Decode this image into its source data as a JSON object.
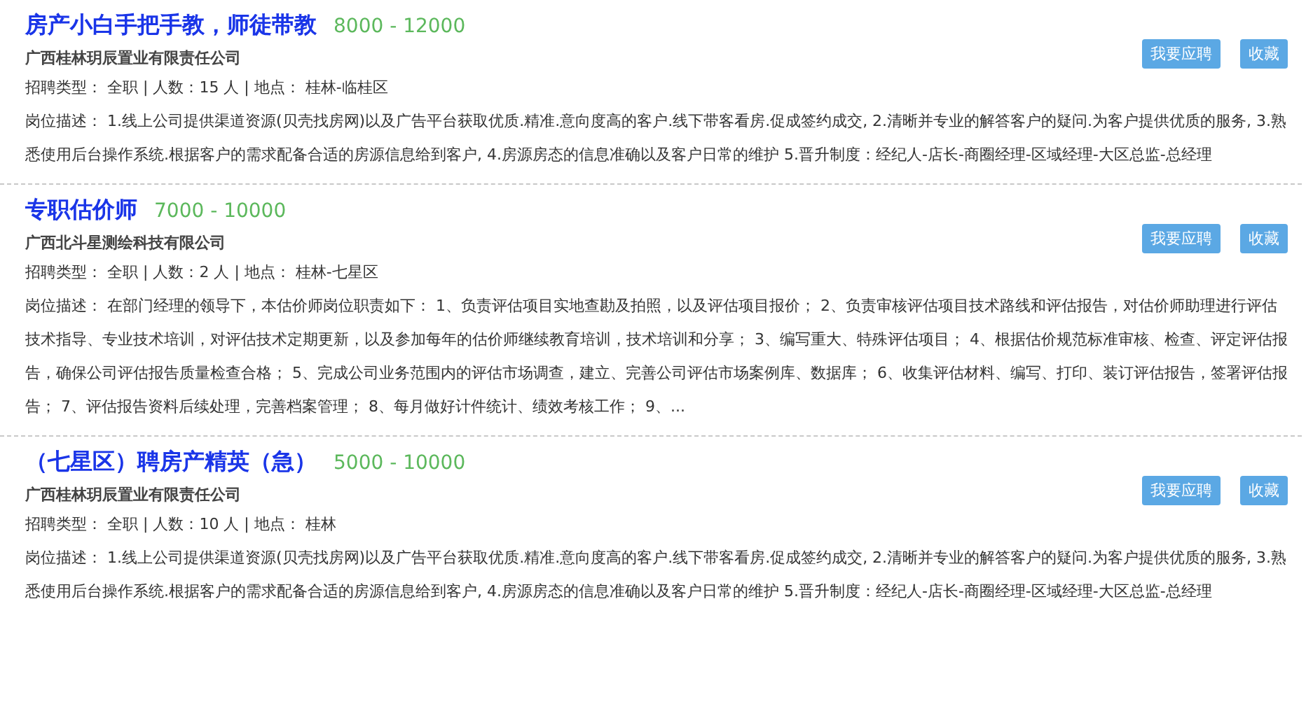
{
  "jobs": [
    {
      "title": "房产小白手把手教，师徒带教",
      "salary": "8000 - 12000",
      "company": "广西桂林玥辰置业有限责任公司",
      "meta": "招聘类型： 全职 | 人数：15 人 | 地点： 桂林-临桂区",
      "desc_label": "岗位描述：",
      "desc": "1.线上公司提供渠道资源(贝壳找房网)以及广告平台获取优质.精准.意向度高的客户.线下带客看房.促成签约成交, 2.清晰并专业的解答客户的疑问.为客户提供优质的服务, 3.熟悉使用后台操作系统.根据客户的需求配备合适的房源信息给到客户, 4.房源房态的信息准确以及客户日常的维护 5.晋升制度：经纪人-店长-商圈经理-区域经理-大区总监-总经理",
      "apply": "我要应聘",
      "save": "收藏"
    },
    {
      "title": "专职估价师",
      "salary": "7000 - 10000",
      "company": "广西北斗星测绘科技有限公司",
      "meta": "招聘类型： 全职 | 人数：2 人 | 地点： 桂林-七星区",
      "desc_label": "岗位描述：",
      "desc": "在部门经理的领导下，本估价师岗位职责如下： 1、负责评估项目实地查勘及拍照，以及评估项目报价； 2、负责审核评估项目技术路线和评估报告，对估价师助理进行评估技术指导、专业技术培训，对评估技术定期更新，以及参加每年的估价师继续教育培训，技术培训和分享； 3、编写重大、特殊评估项目； 4、根据估价规范标准审核、检查、评定评估报告，确保公司评估报告质量检查合格； 5、完成公司业务范围内的评估市场调查，建立、完善公司评估市场案例库、数据库； 6、收集评估材料、编写、打印、装订评估报告，签署评估报告； 7、评估报告资料后续处理，完善档案管理； 8、每月做好计件统计、绩效考核工作； 9、...",
      "apply": "我要应聘",
      "save": "收藏"
    },
    {
      "title": "（七星区）聘房产精英（急）",
      "salary": "5000 - 10000",
      "company": "广西桂林玥辰置业有限责任公司",
      "meta": "招聘类型： 全职 | 人数：10 人 | 地点： 桂林",
      "desc_label": "岗位描述：",
      "desc": "1.线上公司提供渠道资源(贝壳找房网)以及广告平台获取优质.精准.意向度高的客户.线下带客看房.促成签约成交, 2.清晰并专业的解答客户的疑问.为客户提供优质的服务, 3.熟悉使用后台操作系统.根据客户的需求配备合适的房源信息给到客户, 4.房源房态的信息准确以及客户日常的维护 5.晋升制度：经纪人-店长-商圈经理-区域经理-大区总监-总经理",
      "apply": "我要应聘",
      "save": "收藏"
    }
  ]
}
